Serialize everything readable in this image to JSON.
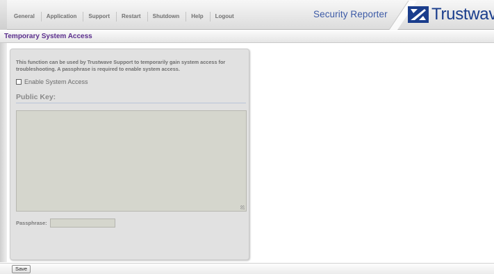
{
  "nav": {
    "items": [
      {
        "label": "General"
      },
      {
        "label": "Application"
      },
      {
        "label": "Support"
      },
      {
        "label": "Restart"
      },
      {
        "label": "Shutdown"
      },
      {
        "label": "Help"
      },
      {
        "label": "Logout"
      }
    ]
  },
  "header": {
    "app_name": "Security Reporter",
    "logo_text": "Trustwave",
    "logo_trademark": "®"
  },
  "page": {
    "title": "Temporary System Access"
  },
  "panel": {
    "description": "This function can be used by Trustwave Support to temporarily gain system access for troubleshooting. A passphrase is required to enable system access.",
    "enable_label": "Enable System Access",
    "enable_checked": false,
    "public_key_title": "Public Key:",
    "public_key_value": "",
    "passphrase_label": "Passphrase:",
    "passphrase_value": ""
  },
  "footer": {
    "save_label": "Save"
  },
  "colors": {
    "accent": "#5a2d8c",
    "app_name": "#3c5aa6",
    "logo": "#1a3d8c"
  }
}
